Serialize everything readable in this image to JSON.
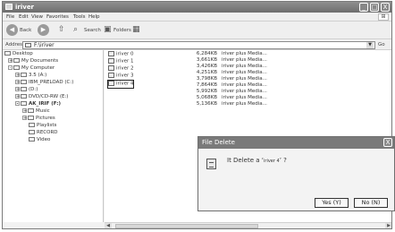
{
  "window": {
    "title": "iriver",
    "buttons": {
      "minimize": "_",
      "maximize": "□",
      "close": "X"
    }
  },
  "menu": {
    "items": [
      "File",
      "Edit",
      "View",
      "Favorites",
      "Tools",
      "Help"
    ]
  },
  "toolbar": {
    "back_label": "Back",
    "search_label": "Search",
    "folders_label": "Folders"
  },
  "address": {
    "label": "Address",
    "value": "F:\\iriver",
    "go_label": "Go"
  },
  "tree": {
    "items": [
      {
        "label": "Desktop",
        "expander": ""
      },
      {
        "label": "My Documents",
        "expander": "+"
      },
      {
        "label": "My Computer",
        "expander": "-"
      },
      {
        "label": "3.5 (A:)",
        "expander": "+"
      },
      {
        "label": "IBM_PRELOAD (C:)",
        "expander": "+"
      },
      {
        "label": "(D:)",
        "expander": "+"
      },
      {
        "label": "DVD/CD-RW (E:)",
        "expander": "+"
      },
      {
        "label": "AK_IRIF (F:)",
        "expander": "-"
      },
      {
        "label": "Music",
        "expander": "+"
      },
      {
        "label": "Pictures",
        "expander": "+"
      },
      {
        "label": "Playlists",
        "expander": ""
      },
      {
        "label": "RECORD",
        "expander": ""
      },
      {
        "label": "Video",
        "expander": ""
      }
    ]
  },
  "files": {
    "names": [
      "iriver 0",
      "iriver 1",
      "iriver 2",
      "iriver 3",
      "iriver 4"
    ],
    "selected": "iriver 4",
    "sizes": [
      "6,284KB",
      "3,661KB",
      "3,426KB",
      "4,251KB",
      "3,798KB",
      "7,864KB",
      "5,992KB",
      "5,068KB",
      "5,136KB"
    ],
    "types": [
      "iriver plus Media...",
      "iriver plus Media...",
      "iriver plus Media...",
      "iriver plus Media...",
      "iriver plus Media...",
      "iriver plus Media...",
      "iriver plus Media...",
      "iriver plus Media...",
      "iriver plus Media..."
    ]
  },
  "dialog": {
    "title": "File Delete",
    "message_pre": "It Delete a ‘",
    "message_file": "iriver 4",
    "message_post": "’ ?",
    "yes_label": "Yes (Y)",
    "no_label": "No (N)",
    "close_label": "X"
  }
}
